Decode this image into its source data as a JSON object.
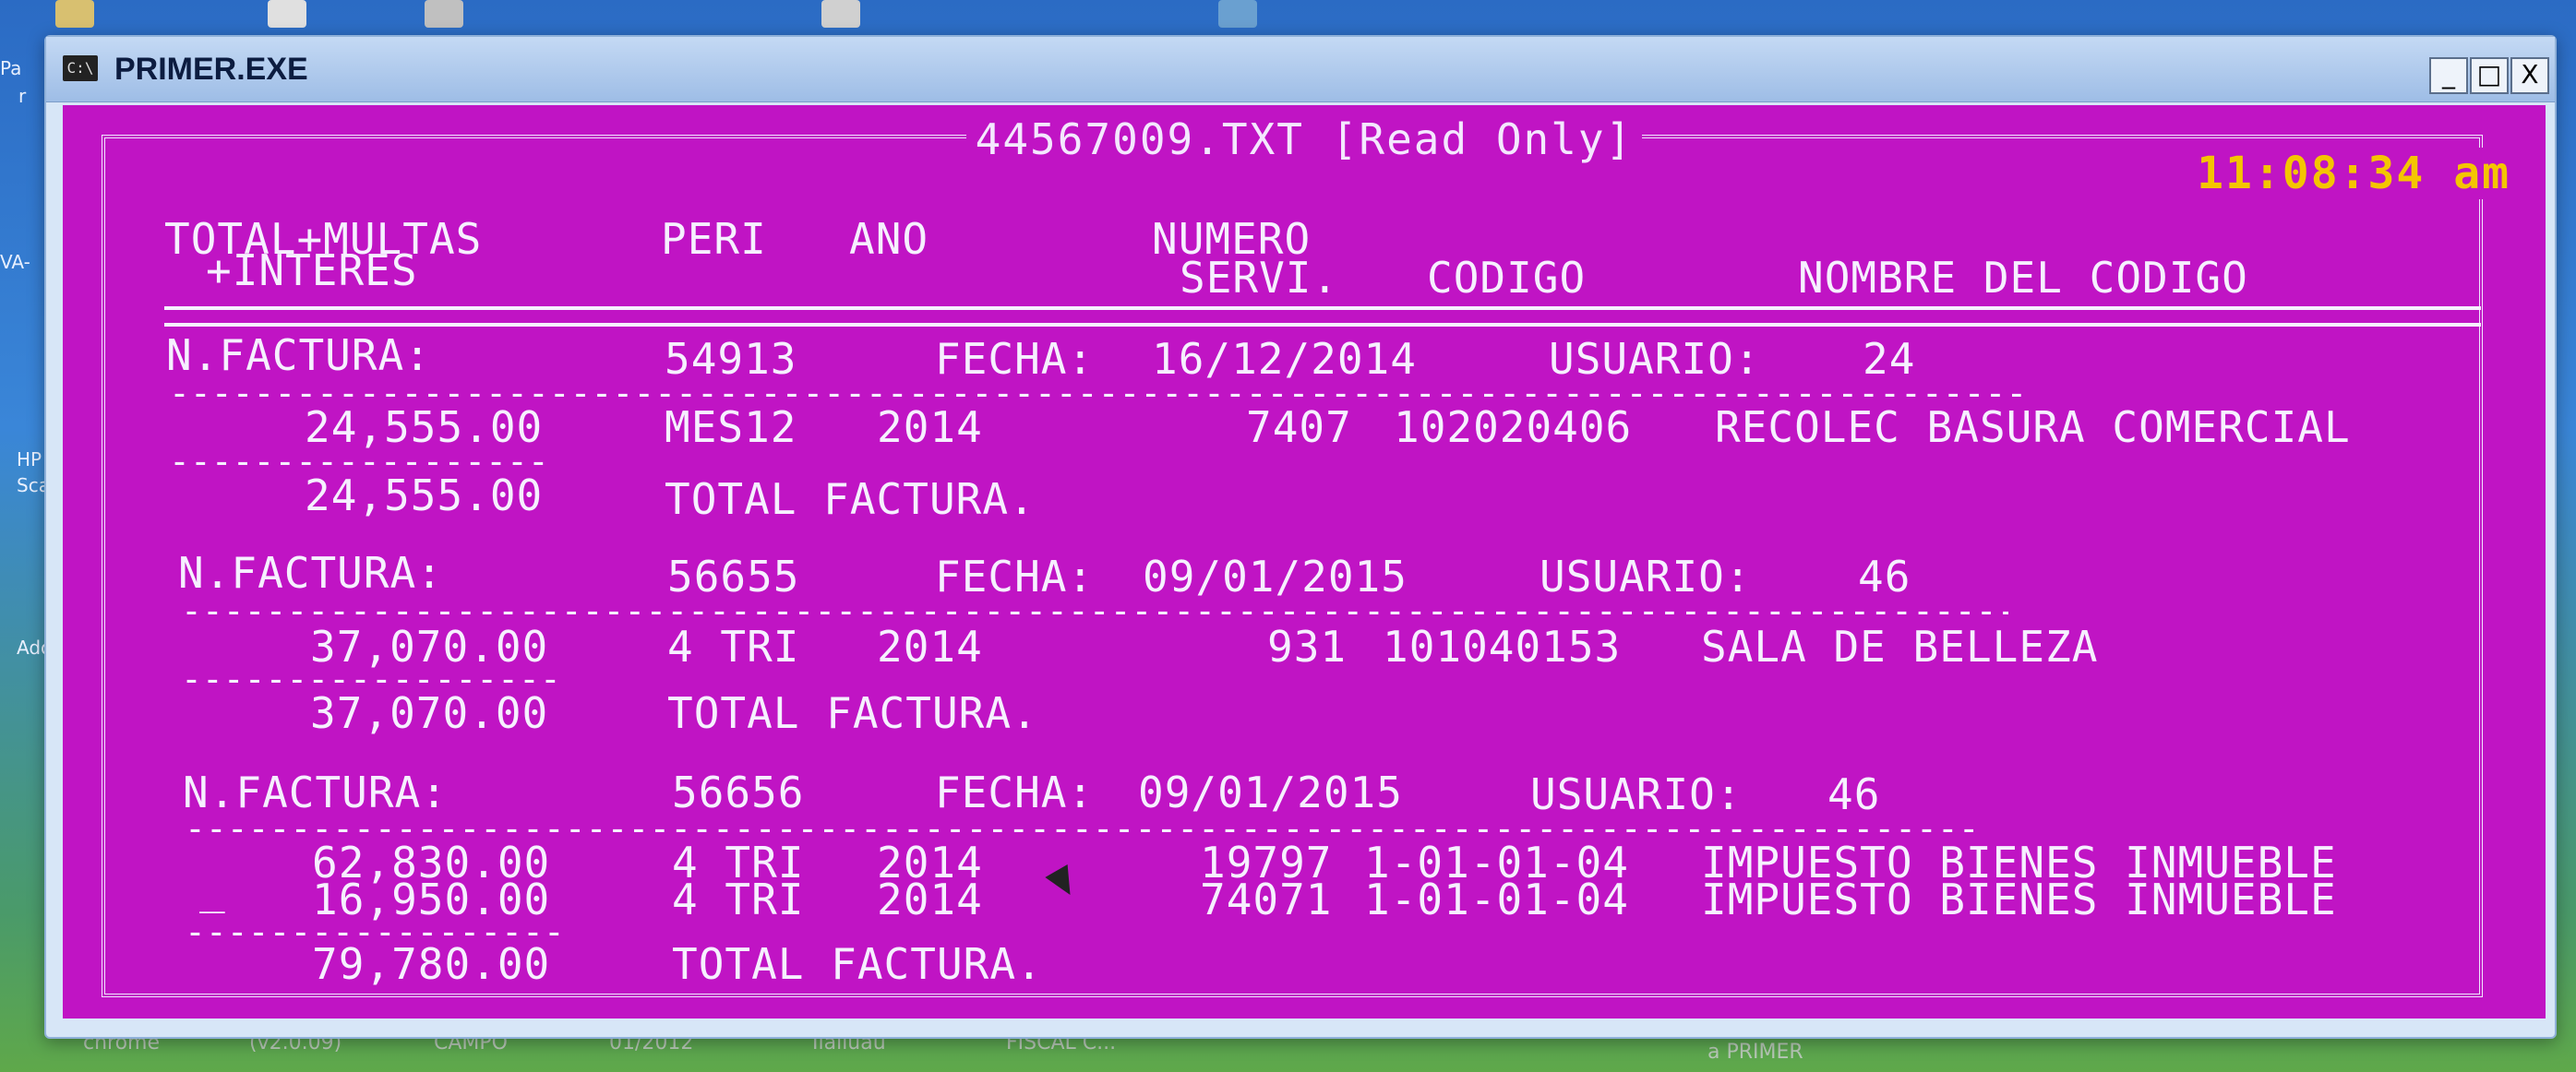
{
  "desktop": {
    "left_labels": [
      "Pa",
      "r",
      "VA-",
      "HP",
      "Sca",
      "Ado"
    ],
    "taskbar_labels": [
      "chrome",
      "(v2.0.09)",
      "CAMPO",
      "01/2012",
      "Ilaliuau",
      "FISCAL C...",
      "a PRIMER"
    ]
  },
  "window": {
    "title": "PRIMER.EXE",
    "icon_label": "C:\\",
    "min_label": "_",
    "max_label": "□",
    "close_label": "X"
  },
  "console": {
    "file_title": "44567009.TXT [Read Only]",
    "clock": "11:08:34 am",
    "headers": {
      "total_line1": "TOTAL+MULTAS",
      "total_line2": "+INTERES",
      "peri": "PERI",
      "ano": "ANO",
      "numero": "NUMERO",
      "servi": "SERVI.",
      "codigo": "CODIGO",
      "nombre": "NOMBRE DEL CODIGO"
    },
    "labels": {
      "factura": "N.FACTURA:",
      "fecha": "FECHA:",
      "usuario": "USUARIO:",
      "total_factura": "TOTAL FACTURA."
    },
    "invoices": [
      {
        "number": "54913",
        "date": "16/12/2014",
        "user": "24",
        "lines": [
          {
            "amount": "24,555.00",
            "period": "MES12",
            "year": "2014",
            "service": "7407",
            "code": "102020406",
            "name": "RECOLEC BASURA COMERCIAL"
          }
        ],
        "total": "24,555.00"
      },
      {
        "number": "56655",
        "date": "09/01/2015",
        "user": "46",
        "lines": [
          {
            "amount": "37,070.00",
            "period": "4 TRI",
            "year": "2014",
            "service": "931",
            "code": "101040153",
            "name": "SALA DE BELLEZA"
          }
        ],
        "total": "37,070.00"
      },
      {
        "number": "56656",
        "date": "09/01/2015",
        "user": "46",
        "lines": [
          {
            "amount": "62,830.00",
            "period": "4 TRI",
            "year": "2014",
            "service": "19797",
            "code": "1-01-01-04",
            "name": "IMPUESTO BIENES INMUEBLE"
          },
          {
            "amount": "16,950.00",
            "period": "4 TRI",
            "year": "2014",
            "service": "74071",
            "code": "1-01-01-04",
            "name": "IMPUESTO BIENES INMUEBLE"
          }
        ],
        "total": "79,780.00"
      }
    ],
    "cursor_mark": "_"
  }
}
